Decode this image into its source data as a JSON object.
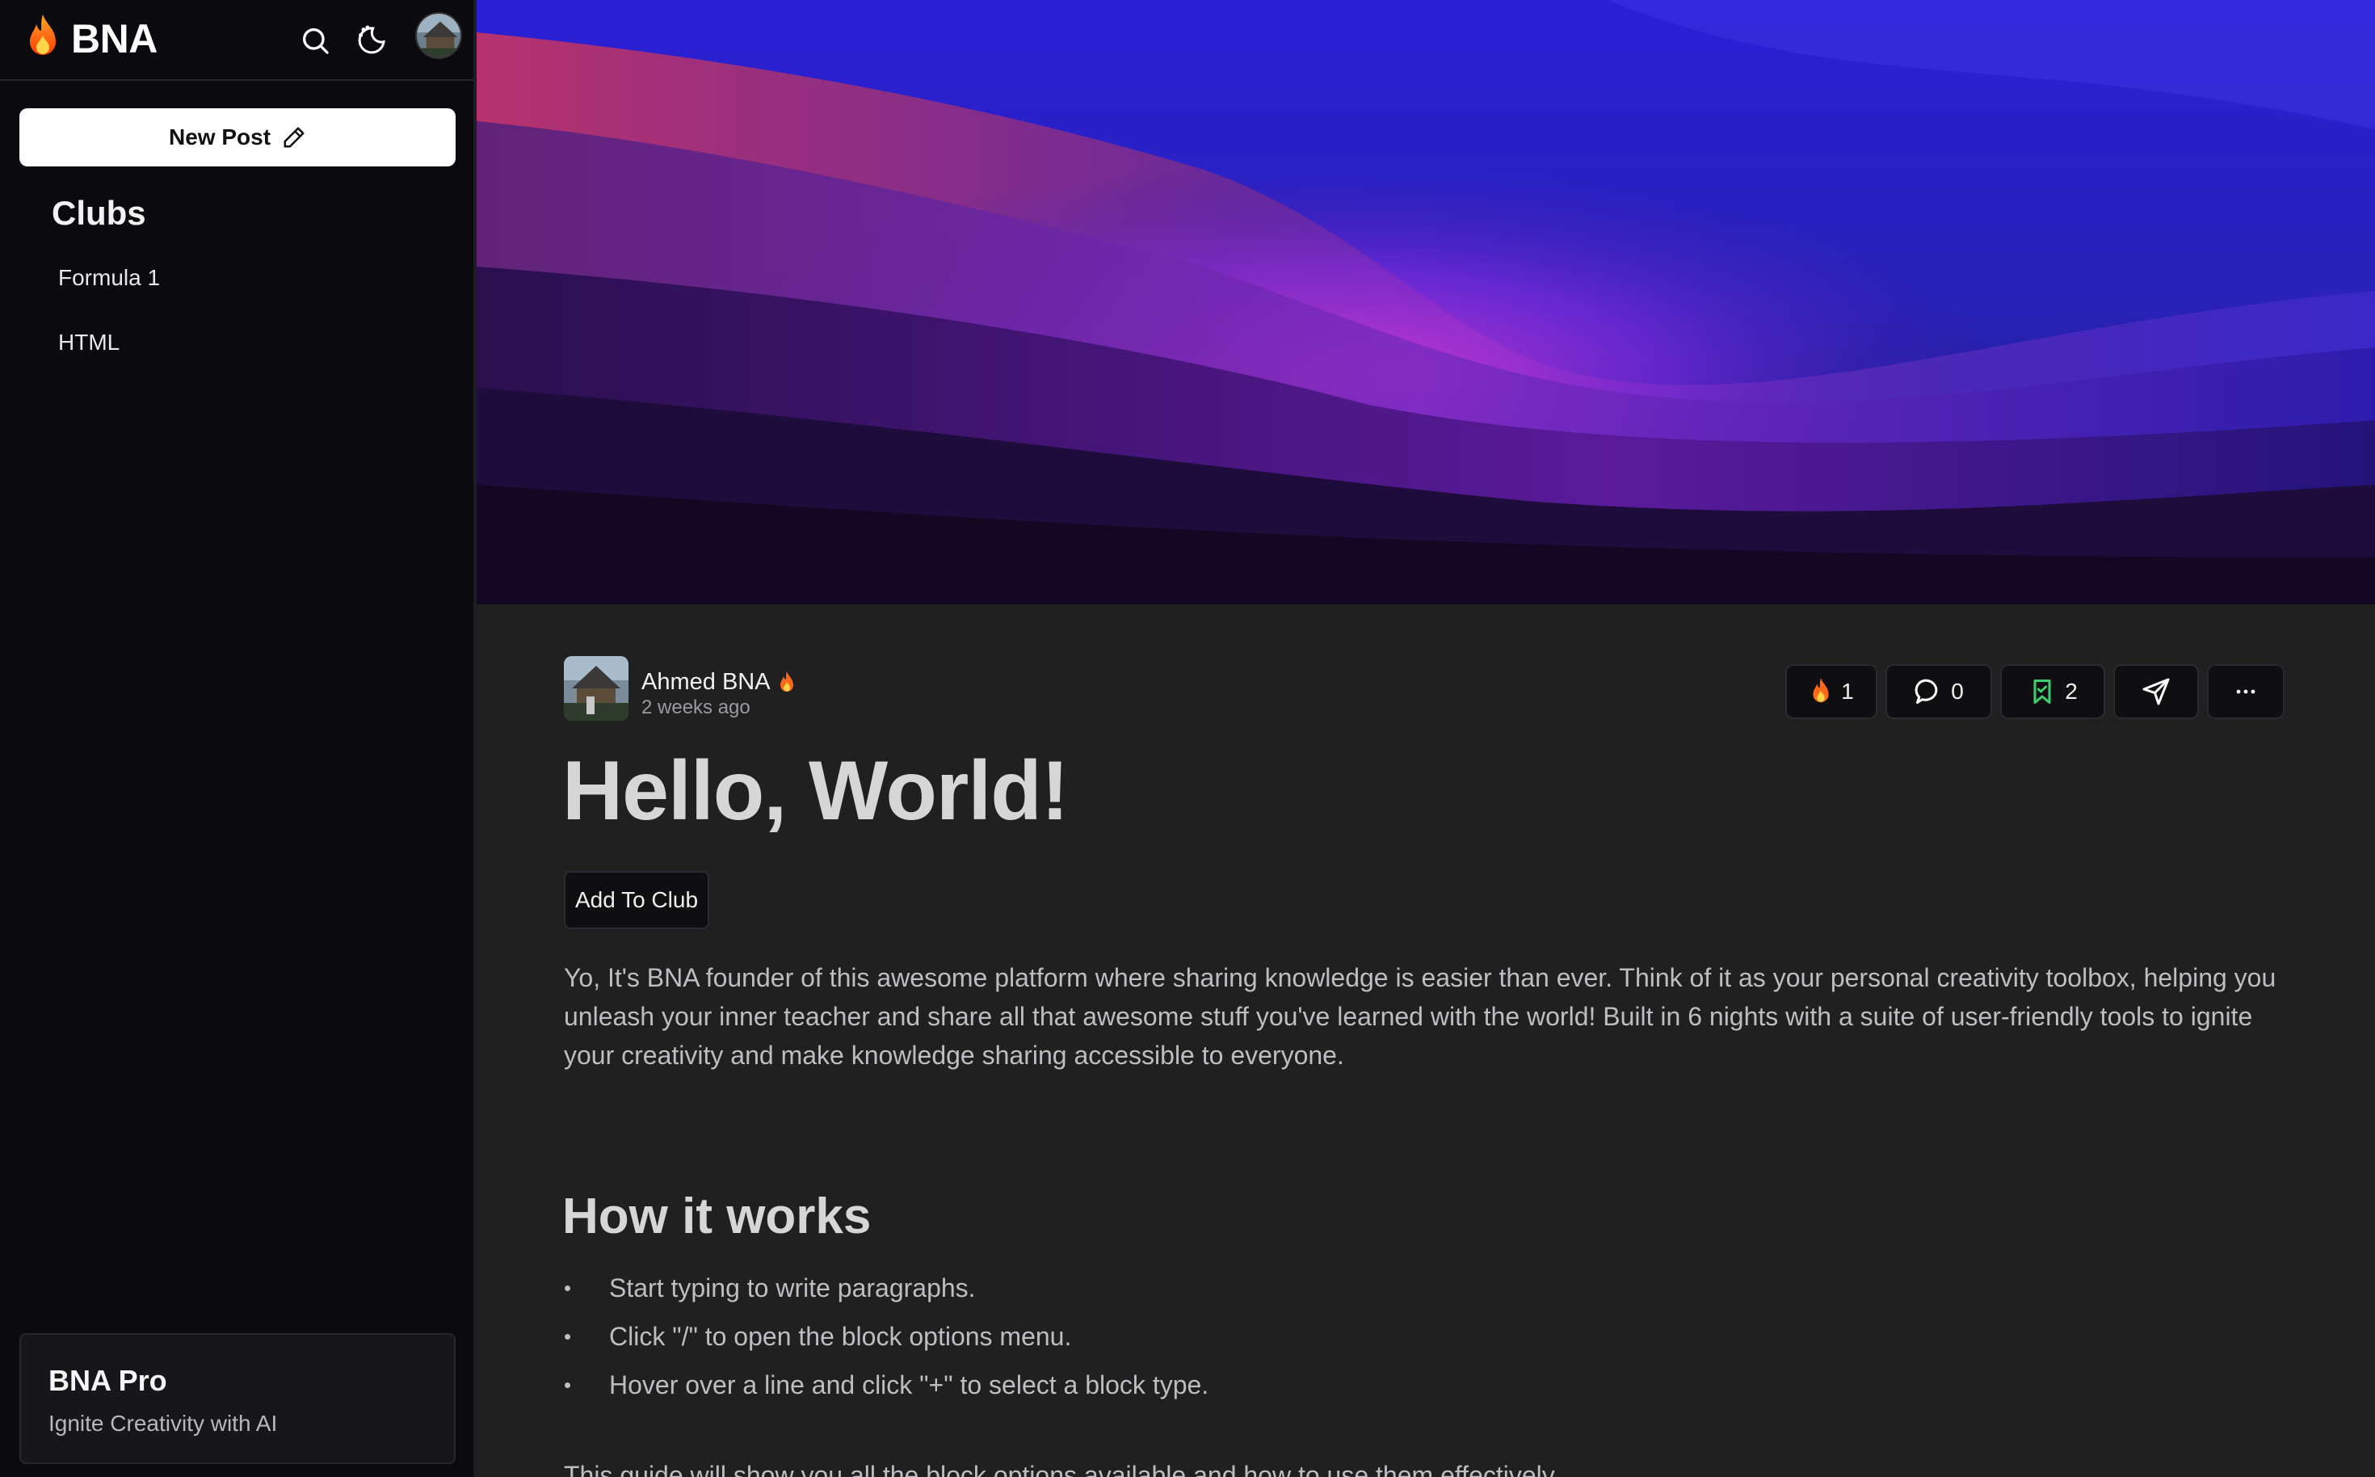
{
  "app": {
    "brand": "BNA",
    "brand_icon": "fire-icon"
  },
  "topbar": {
    "icons": [
      "search-icon",
      "theme-toggle-icon",
      "avatar"
    ]
  },
  "sidebar": {
    "new_post_label": "New Post",
    "new_post_icon": "pencil-icon",
    "clubs_title": "Clubs",
    "clubs": [
      {
        "label": "Formula 1"
      },
      {
        "label": "HTML"
      }
    ],
    "pro_card": {
      "title": "BNA Pro",
      "subtitle": "Ignite Creativity with AI"
    }
  },
  "post": {
    "author": {
      "name": "Ahmed BNA",
      "time": "2 weeks ago"
    },
    "actions": {
      "fire_count": "1",
      "comment_count": "0",
      "bookmark_count": "2"
    },
    "title": "Hello, World!",
    "add_to_club_label": "Add To Club",
    "intro": "Yo, It's BNA founder of this awesome platform where sharing knowledge is easier than ever. Think of it as your personal creativity toolbox, helping you unleash your inner teacher and share all that awesome stuff you've learned with the world! Built in 6 nights with a suite of user-friendly tools to ignite your creativity and make knowledge sharing accessible to everyone.",
    "section_heading": "How it works",
    "bullets": [
      "Start typing to write paragraphs.",
      "Click \"/\" to open the block options menu.",
      "Hover over a line and click \"+\" to select a block type."
    ],
    "bullet_marker": "•",
    "partial_line": "This guide will show you all the block options available and how to use them effectively."
  },
  "colors": {
    "sidebar_bg": "#0b0b0f",
    "main_bg": "#202020",
    "accent_fire": "#ff6a1a",
    "bookmark_green": "#3ccf6e"
  }
}
